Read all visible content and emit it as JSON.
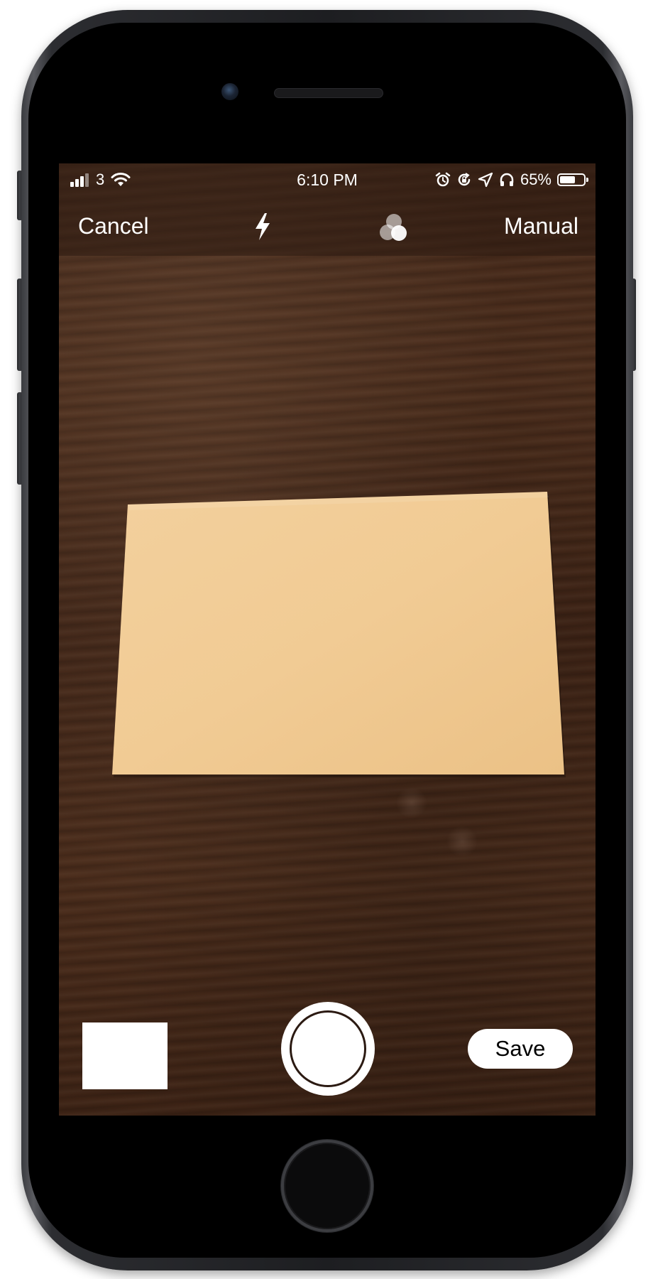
{
  "status_bar": {
    "carrier": "3",
    "time": "6:10 PM",
    "battery_percent_label": "65%",
    "battery_level": 0.65,
    "icons": [
      "cellular-signal-icon",
      "wifi-icon",
      "alarm-icon",
      "rotation-lock-icon",
      "location-arrow-icon",
      "headphones-icon",
      "battery-icon"
    ]
  },
  "nav": {
    "cancel_label": "Cancel",
    "manual_label": "Manual",
    "flash_icon": "flash-icon",
    "filter_icon": "color-filter-icon"
  },
  "controls": {
    "save_label": "Save",
    "shutter_icon": "shutter-button",
    "thumbnail": "last-scan-thumbnail"
  },
  "colors": {
    "document": "#f2cc95",
    "wood": "#45291a",
    "overlay_text": "#ffffff"
  }
}
